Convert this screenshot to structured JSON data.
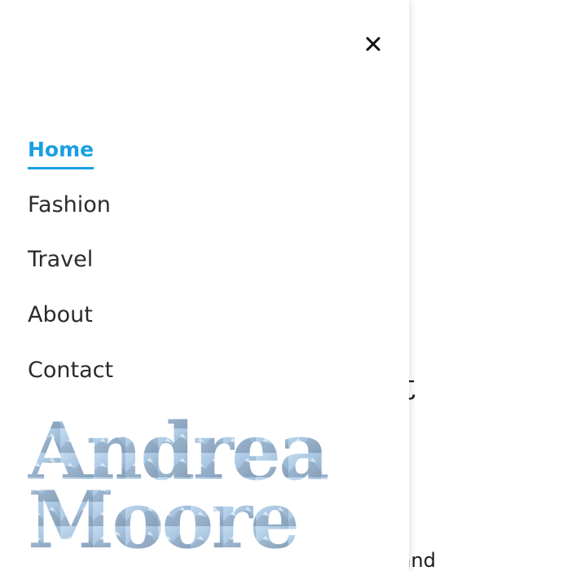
{
  "background": {
    "heading_fragment": "ruest",
    "body_fragment": "r place and"
  },
  "drawer": {
    "close_icon": "close-icon",
    "nav": {
      "items": [
        {
          "label": "Home",
          "active": true
        },
        {
          "label": "Fashion",
          "active": false
        },
        {
          "label": "Travel",
          "active": false
        },
        {
          "label": "About",
          "active": false
        },
        {
          "label": "Contact",
          "active": false
        }
      ]
    },
    "logo": {
      "line1": "Andrea",
      "line2": "Moore"
    }
  },
  "colors": {
    "accent": "#1a9fe0",
    "nav_text": "#2b2b2b",
    "logo_fill_top": "#b9d3ea",
    "logo_fill_bottom": "#8fb6d8"
  }
}
